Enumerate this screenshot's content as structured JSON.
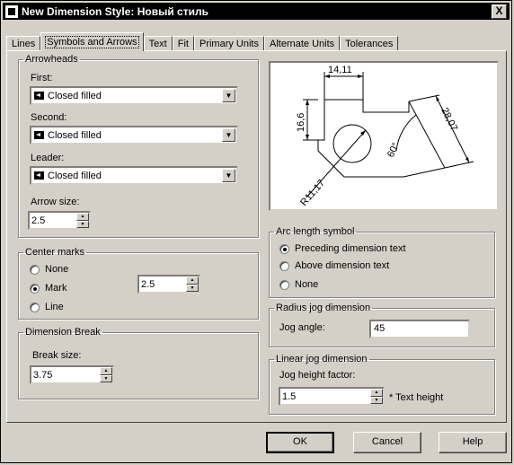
{
  "window": {
    "title": "New Dimension Style: Новый стиль",
    "close_label": "X"
  },
  "tabs": [
    {
      "label": "Lines"
    },
    {
      "label": "Symbols and Arrows"
    },
    {
      "label": "Text"
    },
    {
      "label": "Fit"
    },
    {
      "label": "Primary Units"
    },
    {
      "label": "Alternate Units"
    },
    {
      "label": "Tolerances"
    }
  ],
  "arrowheads": {
    "title": "Arrowheads",
    "first_label": "First:",
    "first_value": "Closed filled",
    "second_label": "Second:",
    "second_value": "Closed filled",
    "leader_label": "Leader:",
    "leader_value": "Closed filled",
    "arrow_size_label": "Arrow size:",
    "arrow_size_value": "2.5"
  },
  "center_marks": {
    "title": "Center marks",
    "none_label": "None",
    "mark_label": "Mark",
    "line_label": "Line",
    "selected": "Mark",
    "size_value": "2.5"
  },
  "dimension_break": {
    "title": "Dimension Break",
    "break_size_label": "Break size:",
    "break_size_value": "3.75"
  },
  "preview": {
    "dim_top": "14,11",
    "dim_left": "16,6",
    "dim_right": "28,07",
    "dim_angle": "60°",
    "dim_radius": "R11,17"
  },
  "arc_length": {
    "title": "Arc length symbol",
    "preceding_label": "Preceding dimension text",
    "above_label": "Above dimension text",
    "none_label": "None",
    "selected": "Preceding dimension text"
  },
  "radius_jog": {
    "title": "Radius jog dimension",
    "jog_angle_label": "Jog angle:",
    "jog_angle_value": "45"
  },
  "linear_jog": {
    "title": "Linear jog dimension",
    "height_factor_label": "Jog height factor:",
    "height_factor_value": "1.5",
    "text_height_label": "* Text height"
  },
  "buttons": {
    "ok": "OK",
    "cancel": "Cancel",
    "help": "Help"
  }
}
